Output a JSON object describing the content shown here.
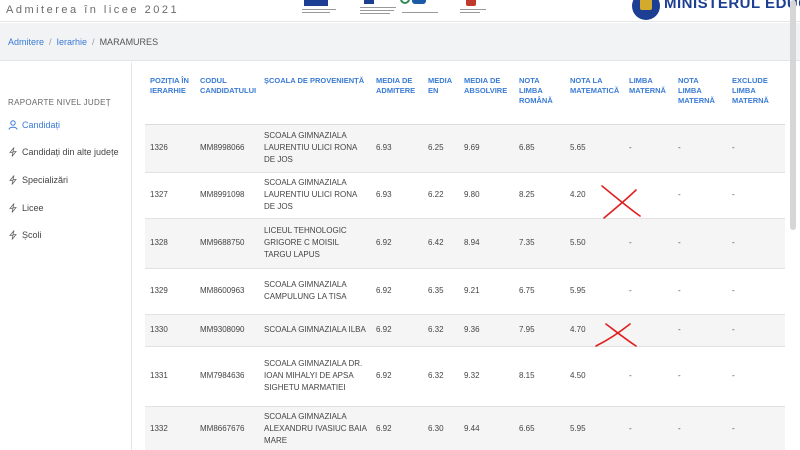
{
  "header": {
    "title": "Admiterea în licee 2021",
    "ministry": "MINISTERUL EDUCAȚIEI"
  },
  "breadcrumb": {
    "items": [
      "Admitere",
      "Ierarhie"
    ],
    "current": "MARAMURES"
  },
  "sidebar": {
    "heading": "RAPOARTE NIVEL JUDEȚ",
    "items": [
      {
        "label": "Candidați",
        "icon": "user-icon",
        "active": true
      },
      {
        "label": "Candidați din alte județe",
        "icon": "bolt-icon"
      },
      {
        "label": "Specializări",
        "icon": "bolt-icon"
      },
      {
        "label": "Licee",
        "icon": "bolt-icon"
      },
      {
        "label": "Școli",
        "icon": "bolt-icon"
      }
    ]
  },
  "table": {
    "columns": [
      "POZIȚIA ÎN IERARHIE",
      "CODUL CANDIDATULUI",
      "ȘCOALA DE PROVENIENȚĂ",
      "MEDIA DE ADMITERE",
      "MEDIA EN",
      "MEDIA DE ABSOLVIRE",
      "NOTA LIMBA ROMÂNĂ",
      "NOTA LA MATEMATICĂ",
      "LIMBA MATERNĂ",
      "NOTA LIMBA MATERNĂ",
      "EXCLUDE LIMBA MATERNĂ"
    ],
    "rows": [
      [
        "1326",
        "MM8998066",
        "SCOALA GIMNAZIALA LAURENTIU ULICI RONA DE JOS",
        "6.93",
        "6.25",
        "9.69",
        "6.85",
        "5.65",
        "-",
        "-",
        "-"
      ],
      [
        "1327",
        "MM8991098",
        "SCOALA GIMNAZIALA LAURENTIU ULICI RONA DE JOS",
        "6.93",
        "6.22",
        "9.80",
        "8.25",
        "4.20",
        "",
        "-",
        "-"
      ],
      [
        "1328",
        "MM9688750",
        "LICEUL TEHNOLOGIC GRIGORE C MOISIL TARGU LAPUS",
        "6.92",
        "6.42",
        "8.94",
        "7.35",
        "5.50",
        "-",
        "-",
        "-"
      ],
      [
        "1329",
        "MM8600963",
        "SCOALA GIMNAZIALA CAMPULUNG LA TISA",
        "6.92",
        "6.35",
        "9.21",
        "6.75",
        "5.95",
        "-",
        "-",
        "-"
      ],
      [
        "1330",
        "MM9308090",
        "SCOALA GIMNAZIALA ILBA",
        "6.92",
        "6.32",
        "9.36",
        "7.95",
        "4.70",
        "",
        "-",
        "-"
      ],
      [
        "1331",
        "MM7984636",
        "SCOALA GIMNAZIALA DR. IOAN MIHALYI DE APSA SIGHETU MARMATIEI",
        "6.92",
        "6.32",
        "9.32",
        "8.15",
        "4.50",
        "-",
        "-",
        "-"
      ],
      [
        "1332",
        "MM8667676",
        "SCOALA GIMNAZIALA ALEXANDRU IVASIUC BAIA MARE",
        "6.92",
        "6.30",
        "9.44",
        "6.65",
        "5.95",
        "-",
        "-",
        "-"
      ]
    ]
  },
  "annotations": {
    "color": "#e02020",
    "marks": [
      "x-mark",
      "x-mark"
    ]
  }
}
